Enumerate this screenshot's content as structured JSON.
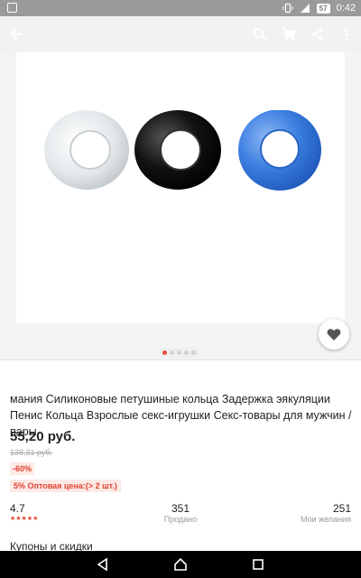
{
  "status_bar": {
    "battery": "57",
    "time": "0:42"
  },
  "toolbar": {
    "back_icon": "arrow-left",
    "search_icon": "search",
    "cart_icon": "shopping-cart",
    "share_icon": "share",
    "more_icon": "more-vertical"
  },
  "gallery": {
    "image_count": 5,
    "active_index": 0,
    "ring_colors": [
      "#dfe5e6",
      "#111111",
      "#3b7fe0"
    ]
  },
  "product": {
    "title": "мания Силиконовые петушиные кольца Задержка эякуляции Пенис Кольца Взрослые секс-игрушки Секс-товары для мужчин / пары",
    "price": "55,20 руб.",
    "old_price": "138,31 руб.",
    "discount": "-60%",
    "wholesale": "5%  Оптовая цена:(> 2 шт.)",
    "rating": "4.7",
    "rating_stars": "★★★★★",
    "sold_count": "351",
    "sold_label": "Продано",
    "wish_count": "251",
    "wish_label": "Мои желания",
    "coupons_label": "Купоны и скидки"
  },
  "colors": {
    "accent": "#e2432f",
    "toolbar_bg": "#f2f2f2",
    "status_bar_bg": "#9a9a9a"
  }
}
